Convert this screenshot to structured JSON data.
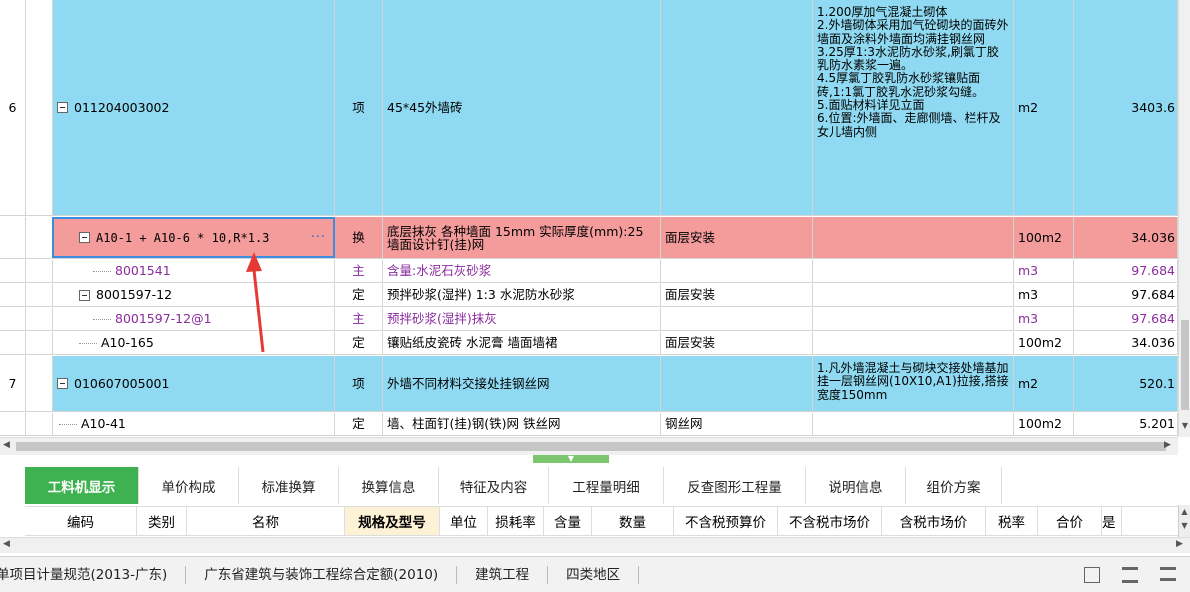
{
  "grid": {
    "rows": [
      {
        "num": "6",
        "code": "011204003002",
        "type": "项",
        "name": "45*45外墙砖",
        "spec": "",
        "desc": "1.200厚加气混凝土砌体\n2.外墙砌体采用加气砼砌块的面砖外墙面及涂料外墙面均满挂钢丝网\n3.25厚1:3水泥防水砂浆,刷氯丁胶乳防水素浆一遍。\n4.5厚氯丁胶乳防水砂浆镶贴面砖,1:1氯丁胶乳水泥砂浆勾缝。\n5.面贴材料详见立面\n6.位置:外墙面、走廊侧墙、栏杆及女儿墙内侧",
        "unit": "m2",
        "qty": "3403.6"
      },
      {
        "num": "",
        "code": "A10-1 + A10-6 * 10,R*1.3",
        "type": "换",
        "name": "底层抹灰 各种墙面 15mm 实际厚度(mm):25 墙面设计钉(挂)网",
        "spec": "面层安装",
        "desc": "",
        "unit": "100m2",
        "qty": "34.036"
      },
      {
        "num": "",
        "code": "8001541",
        "type": "主",
        "name": "含量:水泥石灰砂浆",
        "spec": "",
        "desc": "",
        "unit": "m3",
        "qty": "97.684"
      },
      {
        "num": "",
        "code": "8001597-12",
        "type": "定",
        "name": "预拌砂浆(湿拌) 1:3 水泥防水砂浆",
        "spec": "面层安装",
        "desc": "",
        "unit": "m3",
        "qty": "97.684"
      },
      {
        "num": "",
        "code": "8001597-12@1",
        "type": "主",
        "name": "预拌砂浆(湿拌)抹灰",
        "spec": "",
        "desc": "",
        "unit": "m3",
        "qty": "97.684"
      },
      {
        "num": "",
        "code": "A10-165",
        "type": "定",
        "name": "镶贴纸皮瓷砖 水泥膏 墙面墙裙",
        "spec": "面层安装",
        "desc": "",
        "unit": "100m2",
        "qty": "34.036"
      },
      {
        "num": "7",
        "code": "010607005001",
        "type": "项",
        "name": "外墙不同材料交接处挂钢丝网",
        "spec": "",
        "desc": "1.凡外墙混凝土与砌块交接处墙基加挂一层钢丝网(10X10,A1)拉接,搭接宽度150mm",
        "unit": "m2",
        "qty": "520.1"
      },
      {
        "num": "",
        "code": "A10-41",
        "type": "定",
        "name": "墙、柱面钉(挂)钢(铁)网 铁丝网",
        "spec": "钢丝网",
        "desc": "",
        "unit": "100m2",
        "qty": "5.201"
      }
    ],
    "ellipsis": "···"
  },
  "tabs": [
    "工料机显示",
    "单价构成",
    "标准换算",
    "换算信息",
    "特征及内容",
    "工程量明细",
    "反查图形工程量",
    "说明信息",
    "组价方案"
  ],
  "columns": [
    "编码",
    "类别",
    "名称",
    "规格及型号",
    "单位",
    "损耗率",
    "含量",
    "数量",
    "不含税预算价",
    "不含税市场价",
    "含税市场价",
    "税率",
    "合价",
    "是"
  ],
  "status": [
    "单项目计量规范(2013-广东)",
    "广东省建筑与装饰工程综合定额(2010)",
    "建筑工程",
    "四类地区"
  ],
  "colors": {
    "item_row": "#8fdaf2",
    "selected_row": "#f49b9b",
    "active_tab": "#3eb250",
    "purple_text": "#8a2b9e",
    "arrow": "#e53935"
  }
}
